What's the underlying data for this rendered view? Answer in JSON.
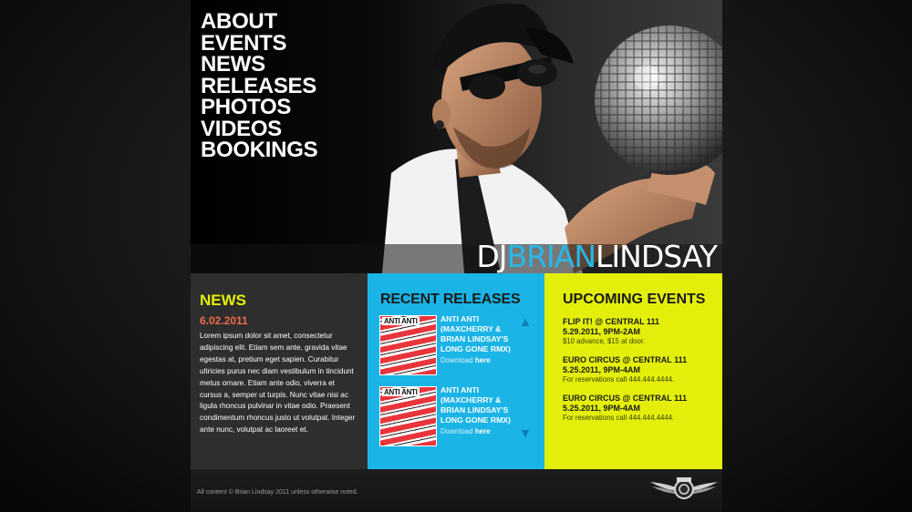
{
  "nav": {
    "items": [
      "ABOUT",
      "EVENTS",
      "NEWS",
      "RELEASES",
      "PHOTOS",
      "VIDEOS",
      "BOOKINGS"
    ]
  },
  "brand": {
    "dj": "DJ",
    "first": "BRIAN",
    "last": "LINDSAY"
  },
  "news": {
    "title": "NEWS",
    "date": "6.02.2011",
    "body": "Lorem ipsum dolor sit amet, consectetur adipiscing elit. Etiam sem ante, gravida vitae egestas at, pretium eget sapien. Curabitur ultricies purus nec diam vestibulum in tincidunt metus ornare. Etiam ante odio, viverra et cursus a, semper ut turpis. Nunc vitae nisi ac ligula rhoncus pulvinar in vitae odio. Praesent condimentum rhoncus justo ut volutpat. Integer ante nunc, volutpat ac laoreet et."
  },
  "releases": {
    "title": "RECENT RELEASES",
    "items": [
      {
        "title": "ANTI ANTI (MAXCHERRY & BRIAN LINDSAY'S LONG GONE RMX)",
        "download_text": "Download",
        "download_link": "here",
        "art_label": "ANTI ANTI"
      },
      {
        "title": "ANTI ANTI (MAXCHERRY & BRIAN LINDSAY'S LONG GONE RMX)",
        "download_text": "Download",
        "download_link": "here",
        "art_label": "ANTI ANTI"
      }
    ],
    "arrow_up": "▲",
    "arrow_down": "▼"
  },
  "events": {
    "title": "UPCOMING EVENTS",
    "items": [
      {
        "name": "FLIP IT! @ CENTRAL 111",
        "date": "5.29.2011, 9PM-2AM",
        "note": "$10 advance, $15 at door."
      },
      {
        "name": "EURO CIRCUS @ CENTRAL 111",
        "date": "5.25.2011, 9PM-4AM",
        "note": "For reservations call 444.444.4444."
      },
      {
        "name": "EURO CIRCUS @ CENTRAL 111",
        "date": "5.25.2011, 9PM-4AM",
        "note": "For reservations call 444.444.4444."
      }
    ]
  },
  "footer": {
    "copyright": "All content © Brian Lindsay 2011 unless otherwise noted."
  },
  "colors": {
    "accent_yellow": "#e3ef0b",
    "accent_blue": "#1ab4e6",
    "date_orange": "#f06a4d"
  }
}
